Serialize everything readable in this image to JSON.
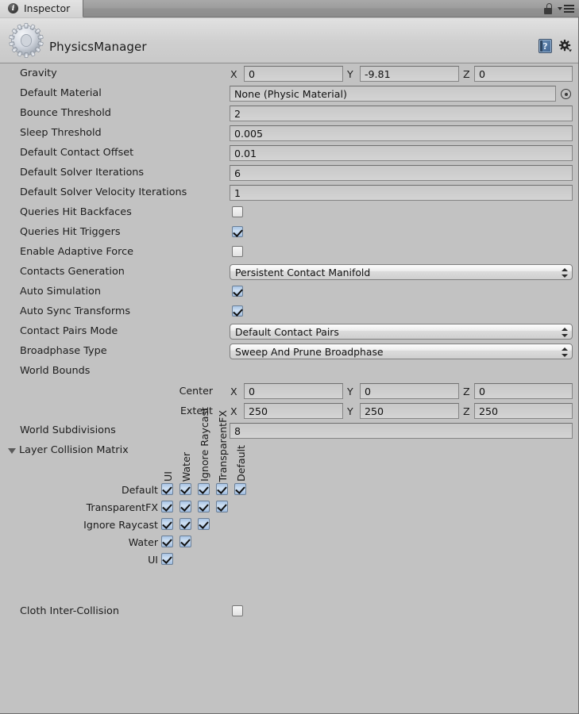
{
  "window": {
    "tab_label": "Inspector",
    "tab_icon": "info-icon",
    "lock_icon": "unlocked-padlock-icon",
    "menu_icon": "hamburger-menu-icon",
    "background_color": "#c2c2c2"
  },
  "header": {
    "title": "PhysicsManager",
    "object_icon": "gear-icon",
    "help_icon": "help-book-icon",
    "settings_icon": "gear-dropdown-icon"
  },
  "properties": [
    {
      "label": "Gravity",
      "type": "vector3",
      "x": "0",
      "y": "-9.81",
      "z": "0"
    },
    {
      "label": "Default Material",
      "type": "object",
      "value": "None (Physic Material)",
      "picker_icon": "object-picker-icon"
    },
    {
      "label": "Bounce Threshold",
      "type": "text",
      "value": "2"
    },
    {
      "label": "Sleep Threshold",
      "type": "text",
      "value": "0.005"
    },
    {
      "label": "Default Contact Offset",
      "type": "text",
      "value": "0.01"
    },
    {
      "label": "Default Solver Iterations",
      "type": "text",
      "value": "6"
    },
    {
      "label": "Default Solver Velocity Iterations",
      "type": "text",
      "value": "1"
    },
    {
      "label": "Queries Hit Backfaces",
      "type": "checkbox",
      "checked": false
    },
    {
      "label": "Queries Hit Triggers",
      "type": "checkbox",
      "checked": true
    },
    {
      "label": "Enable Adaptive Force",
      "type": "checkbox",
      "checked": false
    },
    {
      "label": "Contacts Generation",
      "type": "popup",
      "value": "Persistent Contact Manifold"
    },
    {
      "label": "Auto Simulation",
      "type": "checkbox",
      "checked": true
    },
    {
      "label": "Auto Sync Transforms",
      "type": "checkbox",
      "checked": true
    },
    {
      "label": "Contact Pairs Mode",
      "type": "popup",
      "value": "Default Contact Pairs"
    },
    {
      "label": "Broadphase Type",
      "type": "popup",
      "value": "Sweep And Prune Broadphase"
    }
  ],
  "world_bounds": {
    "group_label": "World Bounds",
    "center": {
      "label": "Center",
      "x": "0",
      "y": "0",
      "z": "0"
    },
    "extent": {
      "label": "Extent",
      "x": "250",
      "y": "250",
      "z": "250"
    }
  },
  "world_subdivisions": {
    "label": "World Subdivisions",
    "value": "8"
  },
  "layer_collision_matrix": {
    "foldout_label": "Layer Collision Matrix",
    "expanded": true,
    "column_labels": [
      "UI",
      "Water",
      "Ignore Raycast",
      "TransparentFX",
      "Default"
    ],
    "rows": [
      {
        "label": "Default",
        "checks": [
          true,
          true,
          true,
          true,
          true
        ]
      },
      {
        "label": "TransparentFX",
        "checks": [
          true,
          true,
          true,
          true
        ]
      },
      {
        "label": "Ignore Raycast",
        "checks": [
          true,
          true,
          true
        ]
      },
      {
        "label": "Water",
        "checks": [
          true,
          true
        ]
      },
      {
        "label": "UI",
        "checks": [
          true
        ]
      }
    ]
  },
  "cloth_inter_collision": {
    "label": "Cloth Inter-Collision",
    "checked": false
  },
  "axis_labels": {
    "x": "X",
    "y": "Y",
    "z": "Z"
  }
}
